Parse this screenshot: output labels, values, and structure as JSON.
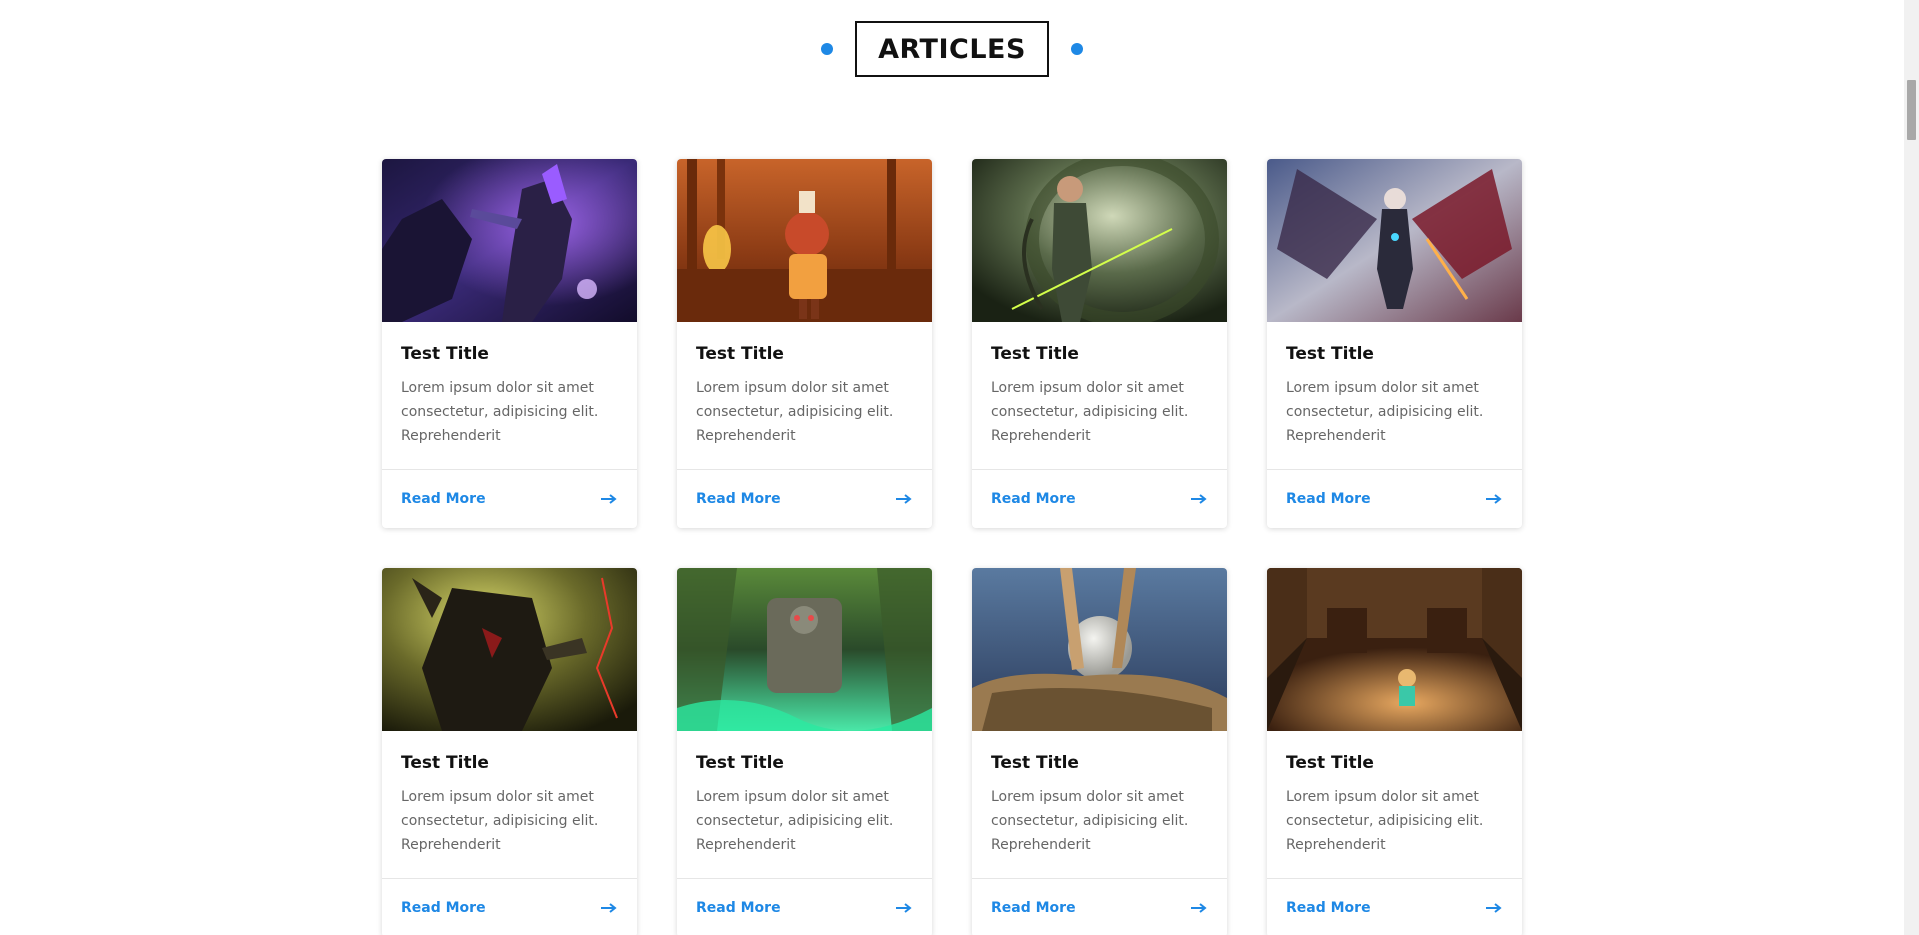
{
  "section": {
    "title": "ARTICLES",
    "accent_color": "#1e88e5"
  },
  "cards": [
    {
      "title": "Test Title",
      "text": "Lorem ipsum dolor sit amet consectetur, adipisicing elit. Reprehenderit",
      "link_label": "Read More",
      "image_theme": "purple-dark-warrior",
      "icon": "arrow-right-icon"
    },
    {
      "title": "Test Title",
      "text": "Lorem ipsum dolor sit amet consectetur, adipisicing elit. Reprehenderit",
      "link_label": "Read More",
      "image_theme": "orange-forest-character",
      "icon": "arrow-right-icon"
    },
    {
      "title": "Test Title",
      "text": "Lorem ipsum dolor sit amet consectetur, adipisicing elit. Reprehenderit",
      "link_label": "Read More",
      "image_theme": "green-archer",
      "icon": "arrow-right-icon"
    },
    {
      "title": "Test Title",
      "text": "Lorem ipsum dolor sit amet consectetur, adipisicing elit. Reprehenderit",
      "link_label": "Read More",
      "image_theme": "winged-demon",
      "icon": "arrow-right-icon"
    },
    {
      "title": "Test Title",
      "text": "Lorem ipsum dolor sit amet consectetur, adipisicing elit. Reprehenderit",
      "link_label": "Read More",
      "image_theme": "dark-knight-olive",
      "icon": "arrow-right-icon"
    },
    {
      "title": "Test Title",
      "text": "Lorem ipsum dolor sit amet consectetur, adipisicing elit. Reprehenderit",
      "link_label": "Read More",
      "image_theme": "green-temple-statue",
      "icon": "arrow-right-icon"
    },
    {
      "title": "Test Title",
      "text": "Lorem ipsum dolor sit amet consectetur, adipisicing elit. Reprehenderit",
      "link_label": "Read More",
      "image_theme": "stone-sphere-blue",
      "icon": "arrow-right-icon"
    },
    {
      "title": "Test Title",
      "text": "Lorem ipsum dolor sit amet consectetur, adipisicing elit. Reprehenderit",
      "link_label": "Read More",
      "image_theme": "wooden-room",
      "icon": "arrow-right-icon"
    }
  ]
}
